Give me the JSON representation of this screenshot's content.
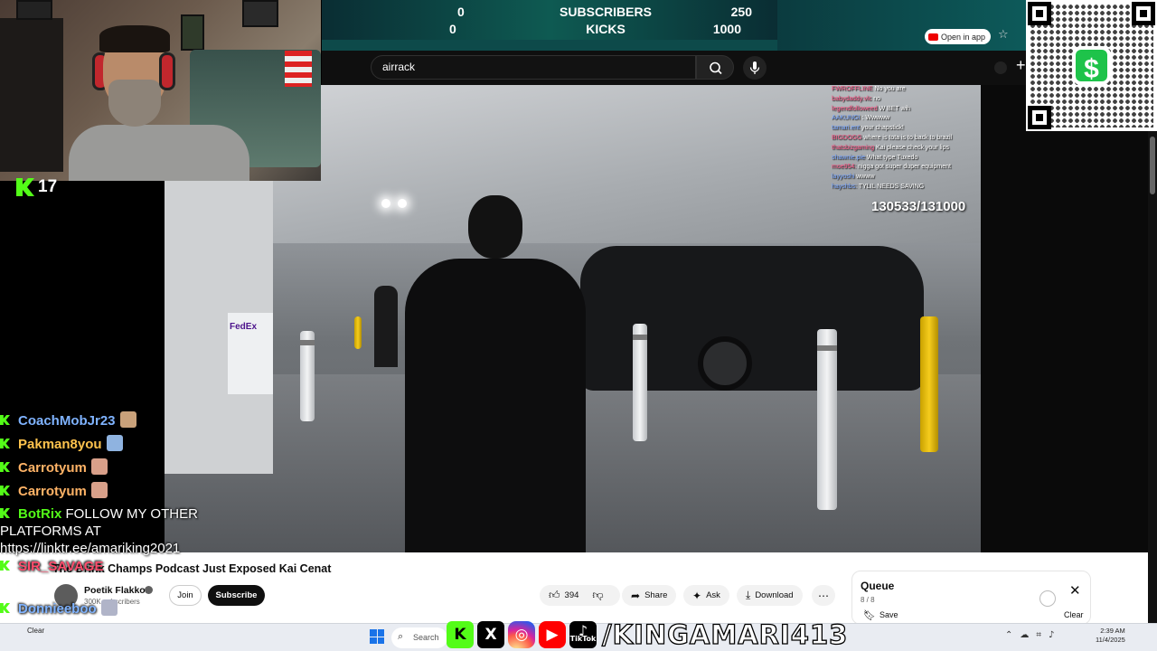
{
  "goal": {
    "subscribers_current": "0",
    "subscribers_label": "SUBSCRIBERS",
    "subscribers_target": "250",
    "kicks_current": "0",
    "kicks_label": "KICKS",
    "kicks_target": "1000"
  },
  "kick": {
    "follower_count": "17",
    "icon": "kick-logo-icon"
  },
  "browser": {
    "open_in_app_label": "Open in app",
    "bookmark_icon": "star-icon"
  },
  "youtube": {
    "search_value": "airrack",
    "video_title": "The Drink Champs Podcast Just Exposed Kai Cenat",
    "channel_name": "Poetik Flakko",
    "channel_subs": "300K subscribers",
    "join_label": "Join",
    "subscribe_label": "Subscribe",
    "like_count": "394",
    "share_label": "Share",
    "ask_label": "Ask",
    "download_label": "Download"
  },
  "video_overlay": {
    "counter": "130533/131000",
    "chat": [
      {
        "user": "FWROFFLINE",
        "text": "No you are"
      },
      {
        "user": "babydaddy.vlc",
        "text": "no"
      },
      {
        "user": "legendfolloweed",
        "text": "W BET wih"
      },
      {
        "user": "AAKUNGI",
        "text": ": Wwwww"
      },
      {
        "user": "tamari.ent",
        "text": "your chapstick!"
      },
      {
        "user": "BIGDOGG",
        "text": "where is tota is to back to brazil"
      },
      {
        "user": "thatsbizgaming",
        "text": "Kai please check your lips"
      },
      {
        "user": "shawnie.pie",
        "text": "What type Tuxedo"
      },
      {
        "user": "moe954:",
        "text": "nigga got super duper equipment"
      },
      {
        "user": "layyoshi",
        "text": "wwww"
      },
      {
        "user": "hayshbs:",
        "text": "TYLIL NEEDS SAVING"
      }
    ]
  },
  "queue": {
    "title": "Queue",
    "count": "8 / 8",
    "save_label": "Save",
    "clear_label": "Clear"
  },
  "stream_chat": [
    {
      "user": "CoachMobJr23",
      "color": "#7fb3ff"
    },
    {
      "user": "Pakman8you",
      "color": "#ffc34d"
    },
    {
      "user": "Carrotyum",
      "color": "#ffb366"
    },
    {
      "user": "Carrotyum",
      "color": "#ffb366"
    },
    {
      "user": "SIR_SAVAGE",
      "color": "#ff4d6d"
    },
    {
      "user": "Donnieeboo",
      "color": "#7fb3ff"
    },
    {
      "user": "Donnieeboo",
      "color": "#7fb3ff"
    }
  ],
  "botrix": {
    "user": "BotRix",
    "message": "FOLLOW MY OTHER PLATFORMS AT https://linktr.ee/amariking2021"
  },
  "socials": {
    "handle": "/KINGAMARI413",
    "tiktok_label": "TikTok"
  },
  "taskbar": {
    "search_label": "Search",
    "weather_label": "Clear",
    "time": "2:39 AM",
    "date": "11/4/2025"
  }
}
